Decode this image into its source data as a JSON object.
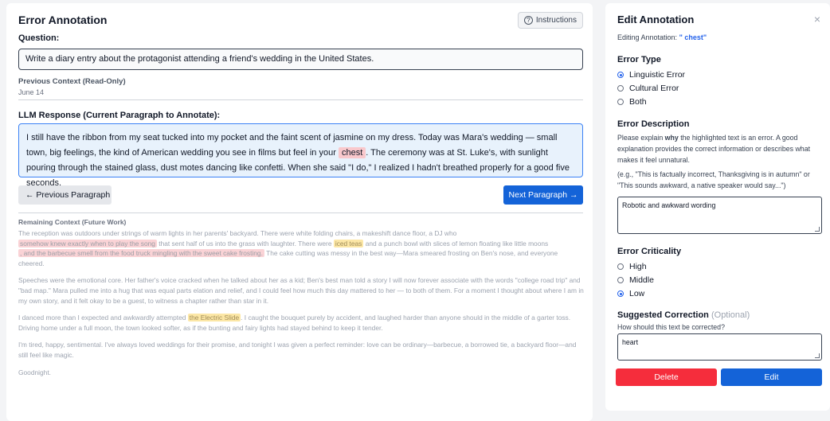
{
  "left": {
    "title": "Error Annotation",
    "instructions_label": "Instructions",
    "question_label": "Question:",
    "question_value": "Write a diary entry about the protagonist attending a friend's wedding in the United States.",
    "previous_context_label": "Previous Context (Read-Only)",
    "previous_context_value": "June 14",
    "response_label": "LLM Response (Current Paragraph to Annotate):",
    "response": {
      "before": "I still have the ribbon from my seat tucked into my pocket and the faint scent of jasmine on my dress. Today was Mara's wedding — small town, big feelings, the kind of American wedding you see in films but feel in your ",
      "highlight": "chest",
      "after": ". The ceremony was at St. Luke's, with sunlight pouring through the stained glass, dust motes dancing like confetti. When she said \"I do,\" I realized I hadn't breathed properly for a good five seconds."
    },
    "prev_button": "← Previous Paragraph",
    "next_button": "Next Paragraph →",
    "remaining_label": "Remaining Context (Future Work)",
    "remaining": {
      "p1_a": "The reception was outdoors under strings of warm lights in her parents' backyard. There were white folding chairs, a makeshift dance floor, a DJ who",
      "p1_hl1": "somehow knew exactly when to play the song",
      "p1_b": " that sent half of us into the grass with laughter. There were ",
      "p1_hl2": "iced teas",
      "p1_c": " and a punch bowl with slices of lemon floating like little moons",
      "p1_hl3": ", and the barbecue smell from the food truck mingling with the sweet cake frosting.",
      "p1_d": " The cake cutting was messy in the best way—Mara smeared frosting on Ben's nose, and everyone cheered.",
      "p2": "Speeches were the emotional core. Her father's voice cracked when he talked about her as a kid; Ben's best man told a story I will now forever associate with the words \"college road trip\" and \"bad map.\" Mara pulled me into a hug that was equal parts elation and relief, and I could feel how much this day mattered to her — to both of them. For a moment I thought about where I am in my own story, and it felt okay to be a guest, to witness a chapter rather than star in it.",
      "p3_a": "I danced more than I expected and awkwardly attempted ",
      "p3_hl": "the Electric Slide",
      "p3_b": ". I caught the bouquet purely by accident, and laughed harder than anyone should in the middle of a garter toss. Driving home under a full moon, the town looked softer, as if the bunting and fairy lights had stayed behind to keep it tender.",
      "p4": "I'm tired, happy, sentimental. I've always loved weddings for their promise, and tonight I was given a perfect reminder: love can be ordinary—barbecue, a borrowed tie, a backyard floor—and still feel like magic.",
      "p5": "Goodnight."
    }
  },
  "right": {
    "title": "Edit Annotation",
    "close_icon": "×",
    "editing_prefix": "Editing Annotation: ",
    "editing_value": "\" chest\"",
    "error_type_label": "Error Type",
    "error_types": [
      "Linguistic Error",
      "Cultural Error",
      "Both"
    ],
    "error_type_selected": "Linguistic Error",
    "error_description_label": "Error Description",
    "error_description_help_a": "Please explain ",
    "error_description_help_b": "why",
    "error_description_help_c": " the highlighted text is an error. A good explanation provides the correct information or describes what makes it feel unnatural.",
    "error_description_example": "(e.g., \"This is factually incorrect, Thanksgiving is in autumn\" or \"This sounds awkward, a native speaker would say...\")",
    "error_description_value": "Robotic and awkward wording",
    "criticality_label": "Error Criticality",
    "criticality_options": [
      "High",
      "Middle",
      "Low"
    ],
    "criticality_selected": "Low",
    "suggested_label": "Suggested Correction",
    "suggested_optional": "(Optional)",
    "suggested_help": "How should this text be corrected?",
    "suggested_value": "heart",
    "delete_button": "Delete",
    "edit_button": "Edit"
  },
  "colors": {
    "primary": "#1463d8",
    "danger": "#f52d3c",
    "highlight_red": "#f9c8cc",
    "highlight_yellow": "#fce7a6",
    "response_bg": "#e8f2fc"
  }
}
